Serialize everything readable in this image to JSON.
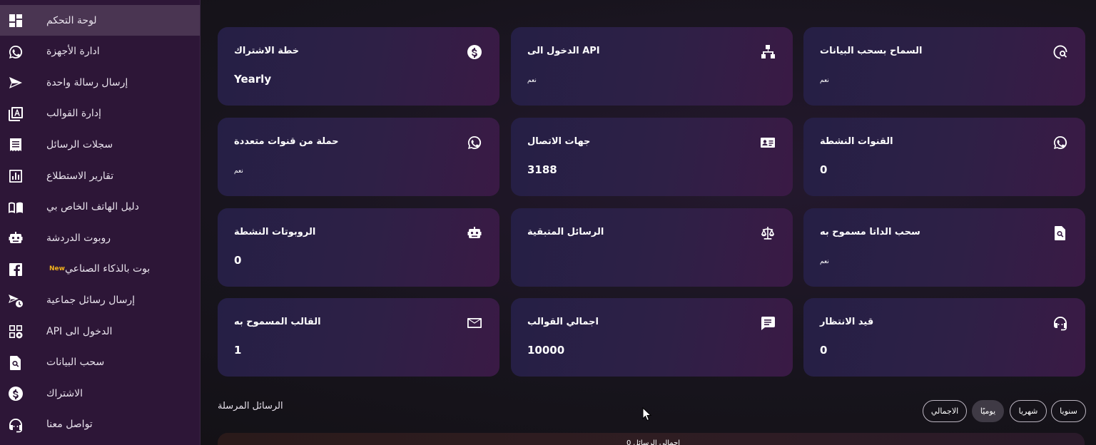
{
  "sidebar": {
    "items": [
      {
        "label": "لوحة التحكم",
        "icon": "dashboard-icon",
        "active": true
      },
      {
        "label": "ادارة الأجهزة",
        "icon": "whatsapp-icon"
      },
      {
        "label": "إرسال رسالة واحدة",
        "icon": "send-icon"
      },
      {
        "label": "إدارة القوالب",
        "icon": "template-icon"
      },
      {
        "label": "سجلات الرسائل",
        "icon": "receipt-icon"
      },
      {
        "label": "تقارير الاستطلاع",
        "icon": "bar-chart-icon"
      },
      {
        "label": "دليل الهاتف الخاص بي",
        "icon": "book-icon"
      },
      {
        "label": "روبوت الدردشة",
        "icon": "robot-icon"
      },
      {
        "label": "بوت بالذكاء الصناعي",
        "icon": "facebook-icon",
        "badge": "New"
      },
      {
        "label": "إرسال رسائل جماعية",
        "icon": "bulk-send-icon"
      },
      {
        "label": "الدخول الى API",
        "icon": "api-icon"
      },
      {
        "label": "سحب البيانات",
        "icon": "file-search-icon"
      },
      {
        "label": "الاشتراك",
        "icon": "dollar-icon"
      },
      {
        "label": "تواصل معنا",
        "icon": "support-icon"
      }
    ]
  },
  "cards": [
    {
      "title": "خطة الاشتراك",
      "value": "Yearly",
      "icon": "dollar-icon"
    },
    {
      "title": "الدخول الى API",
      "value": "نعم",
      "icon": "sitemap-icon"
    },
    {
      "title": "السماح بسحب البيانات",
      "value": "نعم",
      "icon": "scan-search-icon"
    },
    {
      "title": "حملة من قنوات متعددة",
      "value": "نعم",
      "icon": "whatsapp-icon"
    },
    {
      "title": "جهات الاتصال",
      "value": "3188",
      "icon": "contact-card-icon"
    },
    {
      "title": "القنوات النشطة",
      "value": "0",
      "icon": "whatsapp-icon"
    },
    {
      "title": "الروبوتات النشطة",
      "value": "0",
      "icon": "robot-icon"
    },
    {
      "title": "الرسائل المتبقية",
      "value": "",
      "icon": "scale-icon"
    },
    {
      "title": "سحب الداتا مسموح به",
      "value": "نعم",
      "icon": "file-search-icon"
    },
    {
      "title": "القالب المسموح به",
      "value": "1",
      "icon": "mail-icon"
    },
    {
      "title": "اجمالي القوالب",
      "value": "10000",
      "icon": "message-icon"
    },
    {
      "title": "قيد الانتظار",
      "value": "0",
      "icon": "support-icon"
    }
  ],
  "sent_messages": {
    "title": "الرسائل المرسلة",
    "filters": [
      {
        "label": "سنويا"
      },
      {
        "label": "شهريا"
      },
      {
        "label": "يوميًا",
        "active": true
      },
      {
        "label": "الاجمالي"
      }
    ],
    "panel_peek": "اجمالي الرسائل 0"
  },
  "colors": {
    "sidebar_bg": "#2d1637",
    "sidebar_active": "#4a3552",
    "new_badge": "#f2b21c"
  }
}
